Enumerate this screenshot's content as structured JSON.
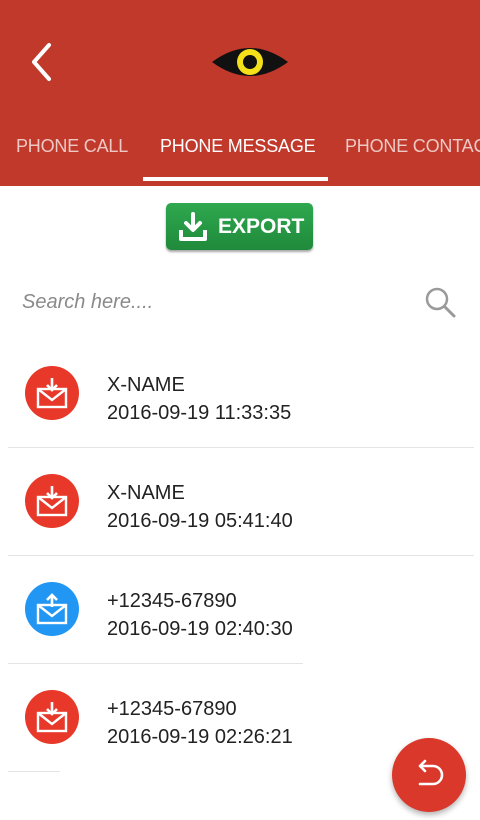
{
  "header": {
    "back_icon": "chevron-left-icon",
    "logo_icon": "eye-icon",
    "colors": {
      "bar": "#c0392b",
      "eye_iris": "#f4e11a"
    }
  },
  "tabs": [
    {
      "label": "PHONE CALL",
      "active": false
    },
    {
      "label": "PHONE MESSAGE",
      "active": true
    },
    {
      "label": "PHONE CONTAC",
      "active": false
    }
  ],
  "export": {
    "label": "EXPORT",
    "icon": "download-icon",
    "color": "#2fa84f"
  },
  "search": {
    "placeholder": "Search here....",
    "value": "",
    "icon": "search-icon"
  },
  "messages": [
    {
      "name": "X-NAME",
      "datetime": "2016-09-19 11:33:35",
      "direction": "received",
      "color": "#e8382a"
    },
    {
      "name": "X-NAME",
      "datetime": "2016-09-19 05:41:40",
      "direction": "received",
      "color": "#e8382a"
    },
    {
      "name": "+12345-67890",
      "datetime": "2016-09-19 02:40:30",
      "direction": "sent",
      "color": "#2196f3"
    },
    {
      "name": "+12345-67890",
      "datetime": "2016-09-19 02:26:21",
      "direction": "received",
      "color": "#e8382a"
    }
  ],
  "fab": {
    "icon": "undo-icon",
    "color": "#d9382a"
  }
}
